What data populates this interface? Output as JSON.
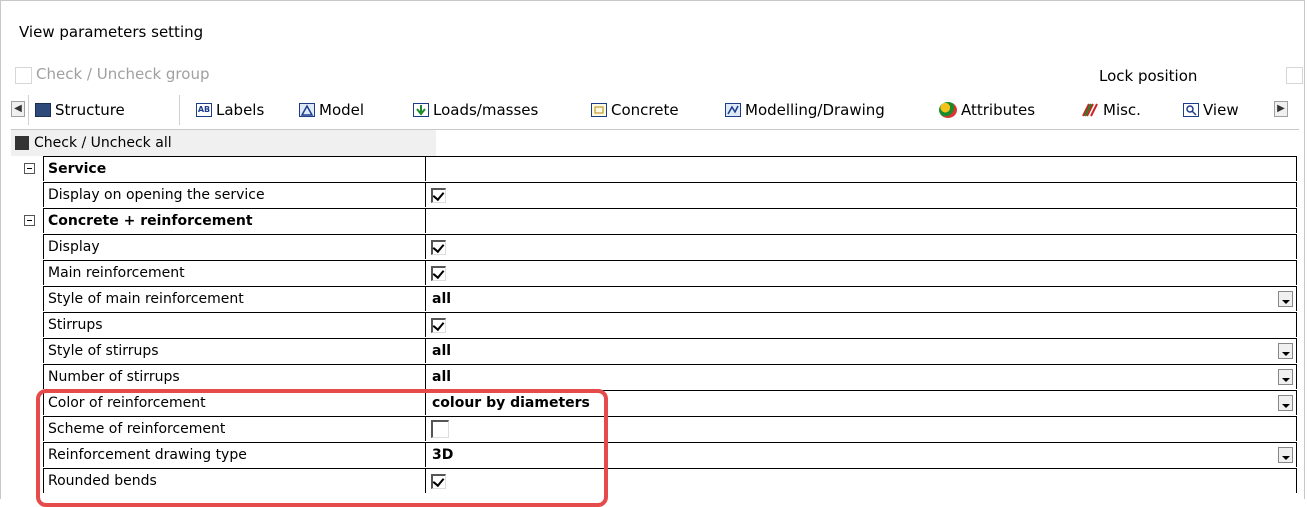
{
  "window": {
    "title": "View parameters setting"
  },
  "options": {
    "group_label": "Check / Uncheck group",
    "lock_label": "Lock position"
  },
  "tabs": [
    {
      "label": "Structure",
      "icon": "structure-icon",
      "active": true
    },
    {
      "label": "Labels",
      "icon": "labels-icon"
    },
    {
      "label": "Model",
      "icon": "model-icon"
    },
    {
      "label": "Loads/masses",
      "icon": "loads-icon"
    },
    {
      "label": "Concrete",
      "icon": "concrete-icon"
    },
    {
      "label": "Modelling/Drawing",
      "icon": "modelling-drawing-icon"
    },
    {
      "label": "Attributes",
      "icon": "attributes-icon"
    },
    {
      "label": "Misc.",
      "icon": "misc-icon"
    },
    {
      "label": "View",
      "icon": "view-icon"
    }
  ],
  "grid": {
    "check_all_label": "Check / Uncheck all",
    "rows": [
      {
        "label": "Service",
        "group": true
      },
      {
        "label": "Display on opening the service",
        "checked": true
      },
      {
        "label": "Concrete + reinforcement",
        "group": true
      },
      {
        "label": "Display",
        "checked": true
      },
      {
        "label": "Main reinforcement",
        "checked": true
      },
      {
        "label": "Style of main reinforcement",
        "value": "all"
      },
      {
        "label": "Stirrups",
        "checked": true
      },
      {
        "label": "Style of stirrups",
        "value": "all"
      },
      {
        "label": "Number of stirrups",
        "value": "all"
      },
      {
        "label": "Color of reinforcement",
        "value": "colour by diameters"
      },
      {
        "label": "Scheme of reinforcement",
        "checked": false
      },
      {
        "label": "Reinforcement drawing type",
        "value": "3D"
      },
      {
        "label": "Rounded bends",
        "checked": true
      }
    ]
  },
  "colors": {
    "highlight": "#e54b4b"
  }
}
